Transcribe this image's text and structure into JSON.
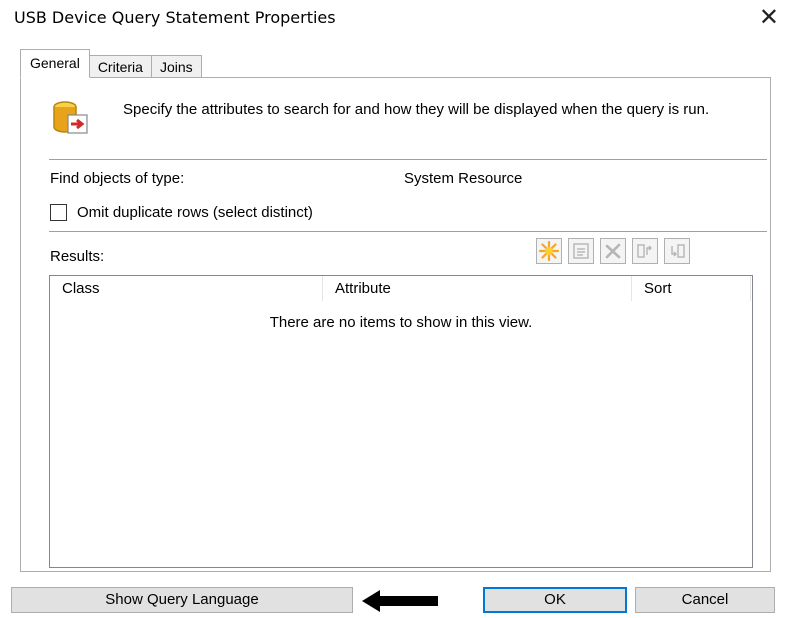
{
  "window": {
    "title": "USB Device Query Statement Properties",
    "close_glyph": "✕"
  },
  "tabs": [
    {
      "label": "General",
      "active": true
    },
    {
      "label": "Criteria",
      "active": false
    },
    {
      "label": "Joins",
      "active": false
    }
  ],
  "general": {
    "description": "Specify the attributes to search for and how they will be displayed when the query is run.",
    "find_label": "Find objects of type:",
    "find_value": "System Resource",
    "omit_duplicates_label": "Omit duplicate rows (select distinct)",
    "omit_duplicates_checked": false,
    "results_label": "Results:",
    "toolbar": [
      {
        "icon": "new-star-icon",
        "enabled": true
      },
      {
        "icon": "properties-icon",
        "enabled": false
      },
      {
        "icon": "delete-icon",
        "enabled": false
      },
      {
        "icon": "move-up-icon",
        "enabled": false
      },
      {
        "icon": "move-down-icon",
        "enabled": false
      }
    ],
    "columns": [
      "Class",
      "Attribute",
      "Sort"
    ],
    "empty_message": "There are no items to show in this view."
  },
  "buttons": {
    "show_query_language": "Show Query Language",
    "ok": "OK",
    "cancel": "Cancel"
  },
  "colors": {
    "accent": "#0078d7",
    "star": "#f5a623"
  }
}
